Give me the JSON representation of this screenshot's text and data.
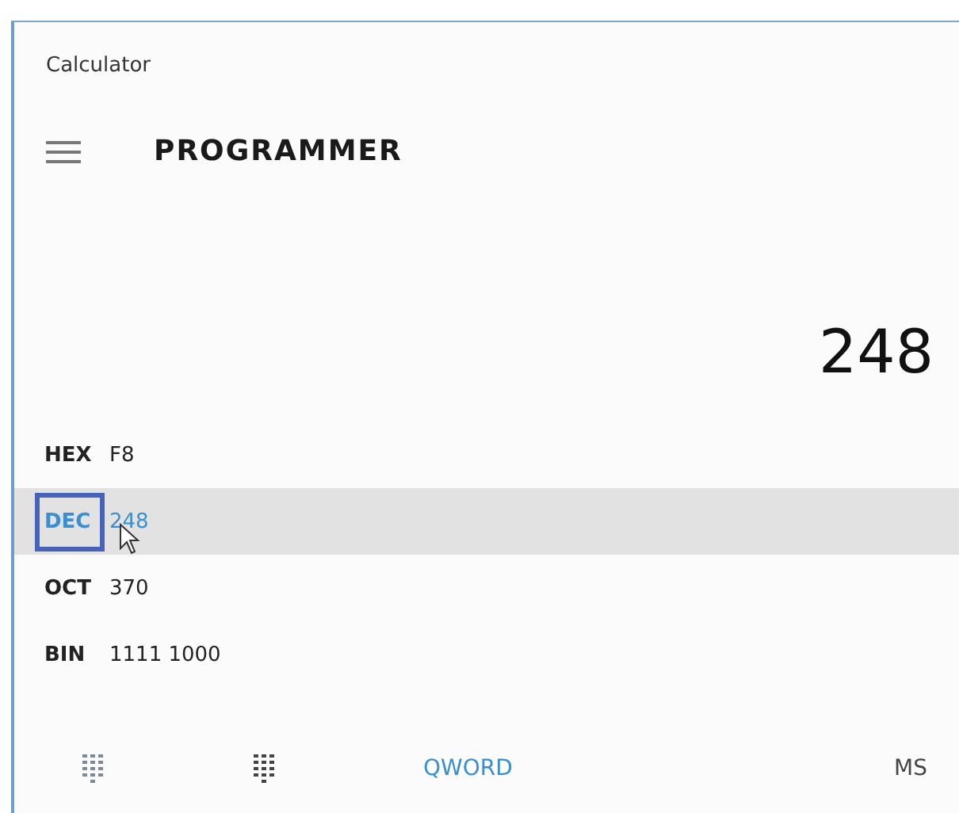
{
  "window": {
    "title": "Calculator"
  },
  "header": {
    "title": "PROGRAMMER"
  },
  "display": {
    "value": "248"
  },
  "radix_rows": [
    {
      "label": "HEX",
      "value": "F8",
      "selected": false,
      "focused": false
    },
    {
      "label": "DEC",
      "value": "248",
      "selected": true,
      "focused": true
    },
    {
      "label": "OCT",
      "value": "370",
      "selected": false,
      "focused": false
    },
    {
      "label": "BIN",
      "value": "1111 1000",
      "selected": false,
      "focused": false
    }
  ],
  "toolbar": {
    "word_size": "QWORD",
    "memory": "MS"
  }
}
